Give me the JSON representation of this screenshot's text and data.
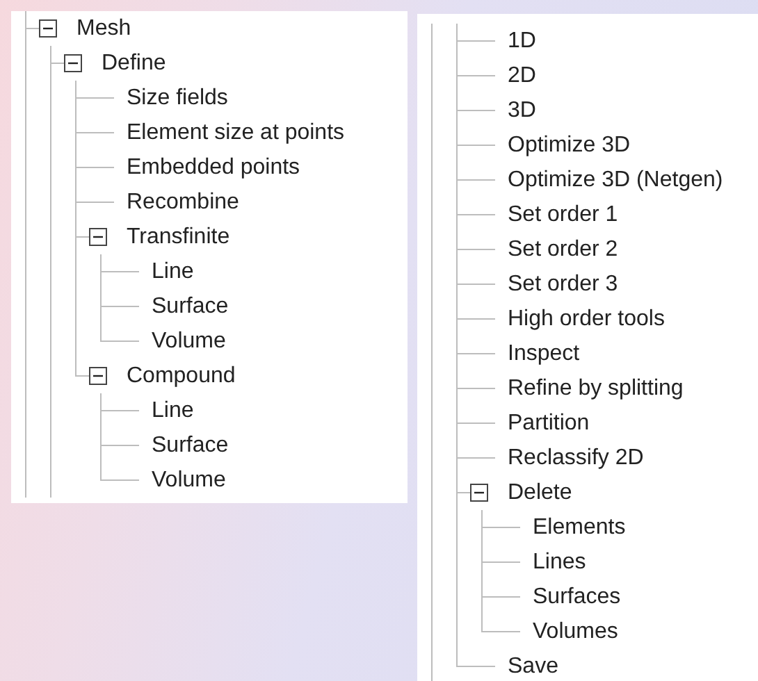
{
  "left_panel": {
    "tree": [
      {
        "label": "Mesh",
        "expanded": true,
        "continues": true,
        "children": [
          {
            "label": "Define",
            "expanded": true,
            "continues": true,
            "children": [
              {
                "label": "Size fields"
              },
              {
                "label": "Element size at points"
              },
              {
                "label": "Embedded points"
              },
              {
                "label": "Recombine"
              },
              {
                "label": "Transfinite",
                "expanded": true,
                "children": [
                  {
                    "label": "Line"
                  },
                  {
                    "label": "Surface"
                  },
                  {
                    "label": "Volume"
                  }
                ]
              },
              {
                "label": "Compound",
                "expanded": true,
                "continues": false,
                "children": [
                  {
                    "label": "Line"
                  },
                  {
                    "label": "Surface"
                  },
                  {
                    "label": "Volume"
                  }
                ]
              }
            ]
          }
        ]
      }
    ]
  },
  "right_panel": {
    "parent_continues": true,
    "tree": [
      {
        "label": "1D"
      },
      {
        "label": "2D"
      },
      {
        "label": "3D"
      },
      {
        "label": "Optimize 3D"
      },
      {
        "label": "Optimize 3D (Netgen)"
      },
      {
        "label": "Set order 1"
      },
      {
        "label": "Set order 2"
      },
      {
        "label": "Set order 3"
      },
      {
        "label": "High order tools"
      },
      {
        "label": "Inspect"
      },
      {
        "label": "Refine by splitting"
      },
      {
        "label": "Partition"
      },
      {
        "label": "Reclassify 2D"
      },
      {
        "label": "Delete",
        "expanded": true,
        "children": [
          {
            "label": "Elements"
          },
          {
            "label": "Lines"
          },
          {
            "label": "Surfaces"
          },
          {
            "label": "Volumes"
          }
        ]
      },
      {
        "label": "Save"
      }
    ]
  }
}
